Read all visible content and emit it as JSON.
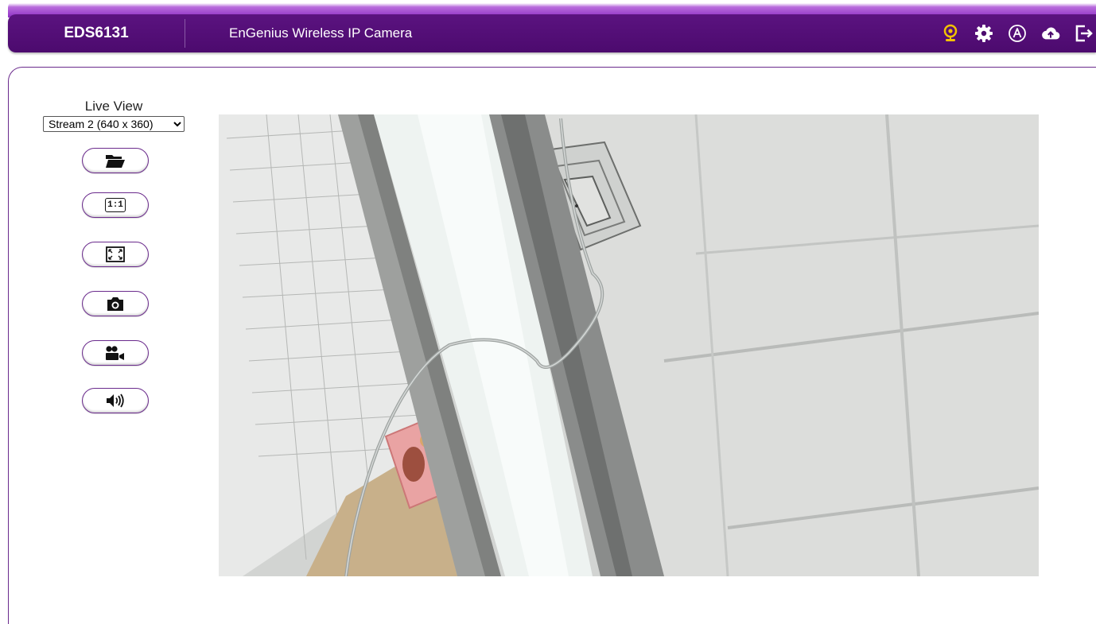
{
  "header": {
    "model": "EDS6131",
    "product": "EnGenius Wireless IP Camera",
    "icons": [
      "webcam-icon",
      "gear-icon",
      "auto-icon",
      "cloud-upload-icon",
      "logout-icon"
    ]
  },
  "live_view": {
    "title": "Live View",
    "stream_options": [
      "Stream 2 (640 x 360)"
    ],
    "selected_stream": "Stream 2 (640 x 360)",
    "ratio_label": "1:1",
    "controls": [
      "folder-icon",
      "ratio-1-1-icon",
      "fullscreen-icon",
      "camera-icon",
      "record-icon",
      "speaker-icon"
    ]
  },
  "colors": {
    "brand": "#4c0a6e",
    "accent": "#8e2fc4",
    "border": "#6a2a8c"
  }
}
